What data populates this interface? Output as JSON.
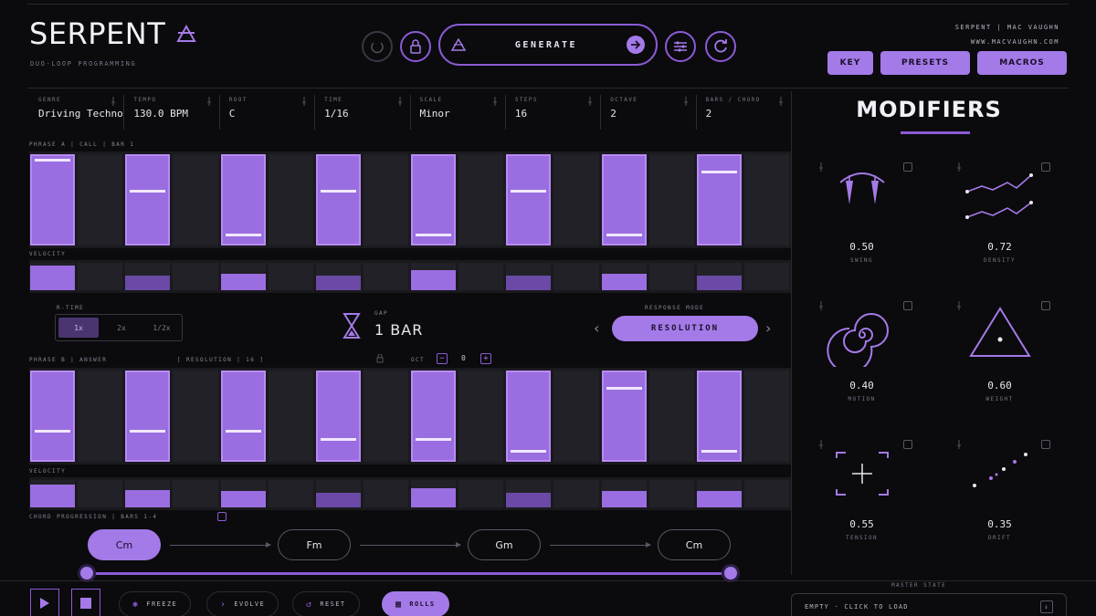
{
  "header": {
    "title": "SERPENT",
    "subtitle": "DUO-LOOP PROGRAMMING",
    "generate_label": "GENERATE",
    "brand_meta_line1": "SERPENT | MAC VAUGHN",
    "brand_meta_line2": "WWW.MACVAUGHN.COM",
    "key_label": "KEY",
    "presets_label": "PRESETS",
    "macros_label": "MACROS"
  },
  "params": [
    {
      "label": "GENRE",
      "value": "Driving Techno"
    },
    {
      "label": "TEMPO",
      "value": "130.0 BPM"
    },
    {
      "label": "ROOT",
      "value": "C"
    },
    {
      "label": "TIME",
      "value": "1/16"
    },
    {
      "label": "SCALE",
      "value": "Minor"
    },
    {
      "label": "STEPS",
      "value": "16"
    },
    {
      "label": "OCTAVE",
      "value": "2"
    },
    {
      "label": "BARS / CHORD",
      "value": "2"
    }
  ],
  "phrase_a": {
    "label": "PHRASE A | CALL | BAR 1",
    "velocity_label": "VELOCITY",
    "note_levels": [
      1.0,
      0.6,
      0.05,
      0.6,
      0.05,
      0.6,
      0.05,
      0.85
    ],
    "velocity_levels": [
      0.9,
      0.55,
      0.6,
      0.55,
      0.75,
      0.55,
      0.6,
      0.55
    ]
  },
  "rate": {
    "label": "R-TIME",
    "options": [
      "1x",
      "2x",
      "1/2x"
    ],
    "selected": "1x"
  },
  "gap": {
    "label": "GAP",
    "value": "1 BAR"
  },
  "response": {
    "label": "RESPONSE MODE",
    "value": "RESOLUTION"
  },
  "phrase_b": {
    "label": "PHRASE B | ANSWER",
    "tag": "[ RESOLUTION | 16 ]",
    "extra": "OCT",
    "note_levels": [
      0.3,
      0.3,
      0.3,
      0.2,
      0.2,
      0.05,
      0.85,
      0.05
    ],
    "velocity_levels": [
      0.85,
      0.65,
      0.6,
      0.55,
      0.7,
      0.55,
      0.6,
      0.6
    ]
  },
  "chords": {
    "label": "CHORD PROGRESSION | BARS 1-4",
    "items": [
      "Cm",
      "Fm",
      "Gm",
      "Cm"
    ],
    "active_index": 0
  },
  "transport": {
    "freeze_label": "FREEZE",
    "evolve_label": "EVOLVE",
    "reset_label": "RESET",
    "rolls_label": "ROLLS"
  },
  "preset_slot": {
    "label": "MASTER STATE",
    "value": "EMPTY · CLICK TO LOAD"
  },
  "modifiers": {
    "title": "MODIFIERS",
    "items": [
      {
        "value": "0.50",
        "label": "SWING",
        "icon": "swing-icon"
      },
      {
        "value": "0.72",
        "label": "DENSITY",
        "icon": "density-icon"
      },
      {
        "value": "0.40",
        "label": "MOTION",
        "icon": "spiral-icon"
      },
      {
        "value": "0.60",
        "label": "WEIGHT",
        "icon": "triangle-icon"
      },
      {
        "value": "0.55",
        "label": "TENSION",
        "icon": "crosshair-icon"
      },
      {
        "value": "0.35",
        "label": "DRIFT",
        "icon": "scatter-icon"
      }
    ]
  },
  "colors": {
    "accent": "#a47ae8",
    "accent_dark": "#8b5bd6",
    "background": "#0b0a0d"
  }
}
